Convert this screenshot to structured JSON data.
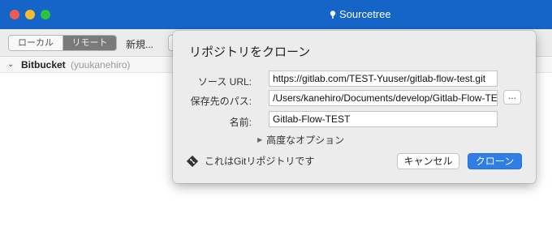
{
  "window": {
    "app_title": "Sourcetree"
  },
  "toolbar": {
    "local_tab": "ローカル",
    "remote_tab": "リモート",
    "new_menu": "新規..."
  },
  "sidebar": {
    "account_name": "Bitbucket",
    "account_user": "(yuukanehiro)"
  },
  "dialog": {
    "title": "リポジトリをクローン",
    "source_url_label": "ソース URL:",
    "source_url_value": "https://gitlab.com/TEST-Yuuser/gitlab-flow-test.git",
    "dest_path_label": "保存先のパス:",
    "dest_path_value": "/Users/kanehiro/Documents/develop/Gitlab-Flow-TEST",
    "browse_label": "...",
    "name_label": "名前:",
    "name_value": "Gitlab-Flow-TEST",
    "advanced_label": "高度なオプション",
    "git_info": "これはGitリポジトリです",
    "cancel_label": "キャンセル",
    "clone_label": "クローン"
  },
  "icons": {
    "app": "sourcetree-icon",
    "git": "git-icon",
    "advanced": "disclosure-triangle-icon",
    "section": "chevron-down-icon"
  },
  "colors": {
    "titlebar": "#1565c9",
    "primary_button": "#2f7ee8"
  }
}
